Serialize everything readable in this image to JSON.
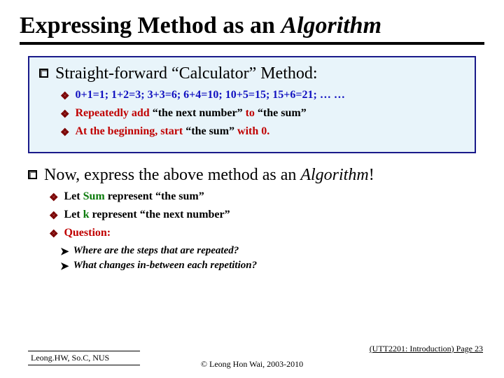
{
  "title_prefix": "Expressing Method as an ",
  "title_algo": "Algorithm",
  "box": {
    "heading": "Straight-forward “Calculator” Method:",
    "e1": "0+1=1;  1+2=3;  3+3=6;  6+4=10;  10+5=15;  15+6=21; … …",
    "e2a": "Repeatedly add ",
    "e2b": "“the next number”",
    "e2c": " to ",
    "e2d": "“the sum”",
    "e3a": "At the beginning, start ",
    "e3b": "“the sum”",
    "e3c": " with 0."
  },
  "sec2": {
    "heading_a": "Now, express the above method as an ",
    "heading_b": "Algorithm",
    "heading_c": "!",
    "s1a": "Let ",
    "s1b": "Sum",
    "s1c": " represent ",
    "s1d": "“the sum”",
    "s2a": "Let ",
    "s2b": "k",
    "s2c": " represent ",
    "s2d": "“the next number”",
    "q_label": "Question:",
    "q1": "Where are the steps that are repeated?",
    "q2": "What changes in-between each repetition?"
  },
  "footer": {
    "left": "Leong.HW, So.C, NUS",
    "mid": "© Leong Hon Wai, 2003-2010",
    "right": "(UTT2201: Introduction) Page 23"
  }
}
